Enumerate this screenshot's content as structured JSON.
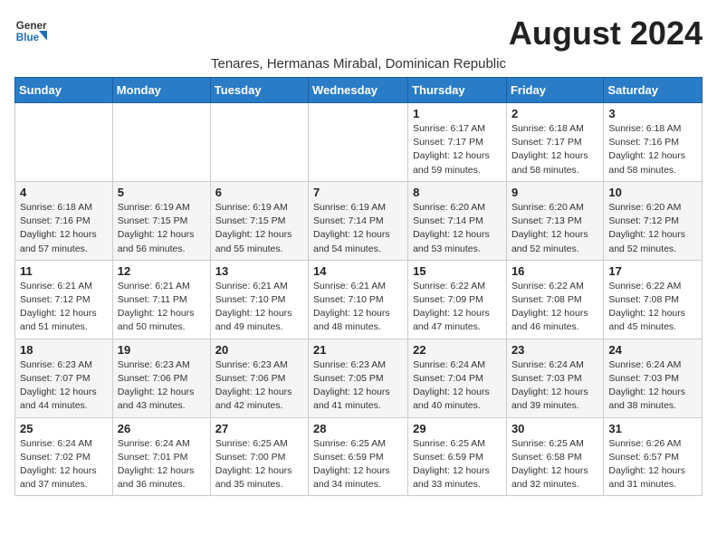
{
  "header": {
    "logo_general": "General",
    "logo_blue": "Blue",
    "month_title": "August 2024",
    "subtitle": "Tenares, Hermanas Mirabal, Dominican Republic"
  },
  "days_of_week": [
    "Sunday",
    "Monday",
    "Tuesday",
    "Wednesday",
    "Thursday",
    "Friday",
    "Saturday"
  ],
  "weeks": [
    [
      {
        "day": "",
        "info": ""
      },
      {
        "day": "",
        "info": ""
      },
      {
        "day": "",
        "info": ""
      },
      {
        "day": "",
        "info": ""
      },
      {
        "day": "1",
        "info": "Sunrise: 6:17 AM\nSunset: 7:17 PM\nDaylight: 12 hours\nand 59 minutes."
      },
      {
        "day": "2",
        "info": "Sunrise: 6:18 AM\nSunset: 7:17 PM\nDaylight: 12 hours\nand 58 minutes."
      },
      {
        "day": "3",
        "info": "Sunrise: 6:18 AM\nSunset: 7:16 PM\nDaylight: 12 hours\nand 58 minutes."
      }
    ],
    [
      {
        "day": "4",
        "info": "Sunrise: 6:18 AM\nSunset: 7:16 PM\nDaylight: 12 hours\nand 57 minutes."
      },
      {
        "day": "5",
        "info": "Sunrise: 6:19 AM\nSunset: 7:15 PM\nDaylight: 12 hours\nand 56 minutes."
      },
      {
        "day": "6",
        "info": "Sunrise: 6:19 AM\nSunset: 7:15 PM\nDaylight: 12 hours\nand 55 minutes."
      },
      {
        "day": "7",
        "info": "Sunrise: 6:19 AM\nSunset: 7:14 PM\nDaylight: 12 hours\nand 54 minutes."
      },
      {
        "day": "8",
        "info": "Sunrise: 6:20 AM\nSunset: 7:14 PM\nDaylight: 12 hours\nand 53 minutes."
      },
      {
        "day": "9",
        "info": "Sunrise: 6:20 AM\nSunset: 7:13 PM\nDaylight: 12 hours\nand 52 minutes."
      },
      {
        "day": "10",
        "info": "Sunrise: 6:20 AM\nSunset: 7:12 PM\nDaylight: 12 hours\nand 52 minutes."
      }
    ],
    [
      {
        "day": "11",
        "info": "Sunrise: 6:21 AM\nSunset: 7:12 PM\nDaylight: 12 hours\nand 51 minutes."
      },
      {
        "day": "12",
        "info": "Sunrise: 6:21 AM\nSunset: 7:11 PM\nDaylight: 12 hours\nand 50 minutes."
      },
      {
        "day": "13",
        "info": "Sunrise: 6:21 AM\nSunset: 7:10 PM\nDaylight: 12 hours\nand 49 minutes."
      },
      {
        "day": "14",
        "info": "Sunrise: 6:21 AM\nSunset: 7:10 PM\nDaylight: 12 hours\nand 48 minutes."
      },
      {
        "day": "15",
        "info": "Sunrise: 6:22 AM\nSunset: 7:09 PM\nDaylight: 12 hours\nand 47 minutes."
      },
      {
        "day": "16",
        "info": "Sunrise: 6:22 AM\nSunset: 7:08 PM\nDaylight: 12 hours\nand 46 minutes."
      },
      {
        "day": "17",
        "info": "Sunrise: 6:22 AM\nSunset: 7:08 PM\nDaylight: 12 hours\nand 45 minutes."
      }
    ],
    [
      {
        "day": "18",
        "info": "Sunrise: 6:23 AM\nSunset: 7:07 PM\nDaylight: 12 hours\nand 44 minutes."
      },
      {
        "day": "19",
        "info": "Sunrise: 6:23 AM\nSunset: 7:06 PM\nDaylight: 12 hours\nand 43 minutes."
      },
      {
        "day": "20",
        "info": "Sunrise: 6:23 AM\nSunset: 7:06 PM\nDaylight: 12 hours\nand 42 minutes."
      },
      {
        "day": "21",
        "info": "Sunrise: 6:23 AM\nSunset: 7:05 PM\nDaylight: 12 hours\nand 41 minutes."
      },
      {
        "day": "22",
        "info": "Sunrise: 6:24 AM\nSunset: 7:04 PM\nDaylight: 12 hours\nand 40 minutes."
      },
      {
        "day": "23",
        "info": "Sunrise: 6:24 AM\nSunset: 7:03 PM\nDaylight: 12 hours\nand 39 minutes."
      },
      {
        "day": "24",
        "info": "Sunrise: 6:24 AM\nSunset: 7:03 PM\nDaylight: 12 hours\nand 38 minutes."
      }
    ],
    [
      {
        "day": "25",
        "info": "Sunrise: 6:24 AM\nSunset: 7:02 PM\nDaylight: 12 hours\nand 37 minutes."
      },
      {
        "day": "26",
        "info": "Sunrise: 6:24 AM\nSunset: 7:01 PM\nDaylight: 12 hours\nand 36 minutes."
      },
      {
        "day": "27",
        "info": "Sunrise: 6:25 AM\nSunset: 7:00 PM\nDaylight: 12 hours\nand 35 minutes."
      },
      {
        "day": "28",
        "info": "Sunrise: 6:25 AM\nSunset: 6:59 PM\nDaylight: 12 hours\nand 34 minutes."
      },
      {
        "day": "29",
        "info": "Sunrise: 6:25 AM\nSunset: 6:59 PM\nDaylight: 12 hours\nand 33 minutes."
      },
      {
        "day": "30",
        "info": "Sunrise: 6:25 AM\nSunset: 6:58 PM\nDaylight: 12 hours\nand 32 minutes."
      },
      {
        "day": "31",
        "info": "Sunrise: 6:26 AM\nSunset: 6:57 PM\nDaylight: 12 hours\nand 31 minutes."
      }
    ]
  ]
}
